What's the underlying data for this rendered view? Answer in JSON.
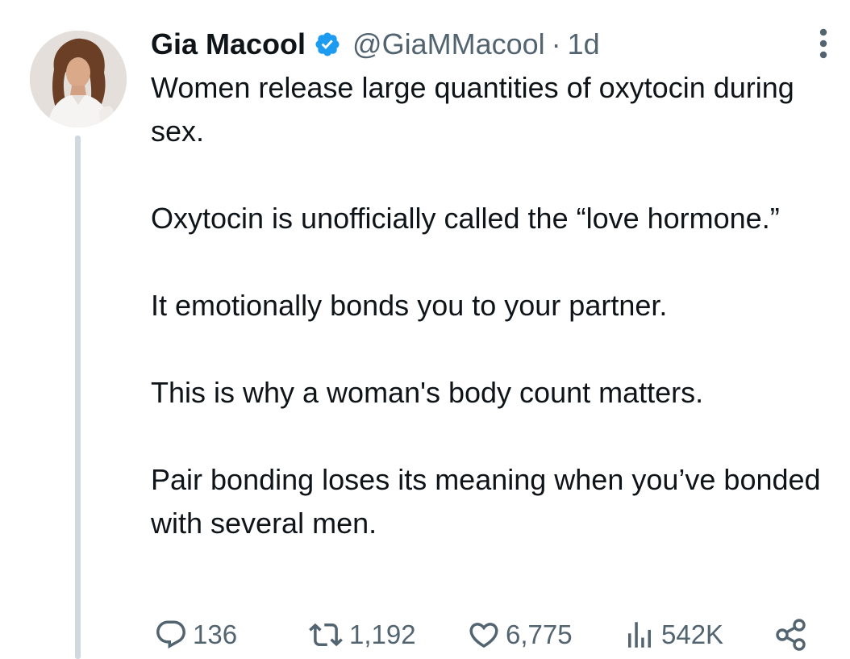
{
  "tweet": {
    "author": {
      "display_name": "Gia Macool",
      "handle": "@GiaMMacool",
      "verified": true
    },
    "separator": "·",
    "time": "1d",
    "paragraphs": [
      "Women release large quantities of oxytocin during sex.",
      "Oxytocin is unofficially called the “love hormone.”",
      "It emotionally bonds you to your partner.",
      "This is why a woman's body count matters.",
      "Pair bonding loses its meaning when you’ve bonded with several men."
    ],
    "actions": {
      "replies": "136",
      "retweets": "1,192",
      "likes": "6,775",
      "views": "542K"
    },
    "icons": {
      "verified": "verified-badge-icon",
      "more": "more-vertical-icon",
      "reply": "reply-icon",
      "retweet": "retweet-icon",
      "like": "heart-icon",
      "views": "views-bar-icon",
      "share": "share-icon"
    },
    "colors": {
      "text": "#0f1419",
      "secondary": "#536471",
      "verified": "#1d9bf0",
      "thread_line": "#cfd9de"
    }
  }
}
